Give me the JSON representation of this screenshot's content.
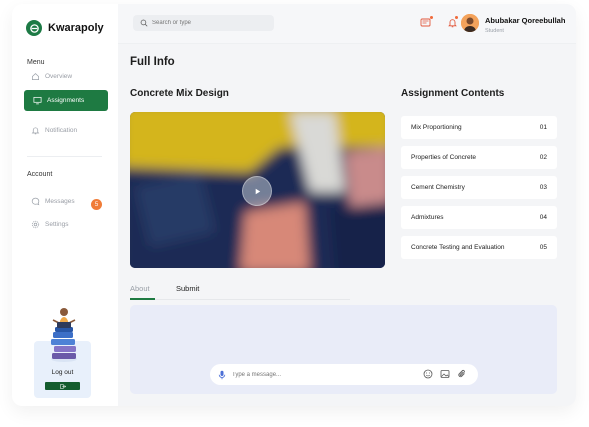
{
  "brand": {
    "name": "Kwarapoly"
  },
  "sidebar": {
    "menu_label": "Menu",
    "account_label": "Account",
    "items": [
      {
        "label": "Overview",
        "icon": "home-icon"
      },
      {
        "label": "Assignments",
        "icon": "monitor-icon",
        "active": true
      },
      {
        "label": "Notification",
        "icon": "bell-icon"
      }
    ],
    "account_items": [
      {
        "label": "Messages",
        "icon": "chat-icon",
        "badge": "5"
      },
      {
        "label": "Settings",
        "icon": "gear-icon"
      }
    ],
    "logout_label": "Log out"
  },
  "topbar": {
    "search_placeholder": "Search or type",
    "user_name": "Abubakar Qoreebullah",
    "user_role": "Student"
  },
  "main": {
    "page_title": "Full Info",
    "course_title": "Concrete Mix Design",
    "contents_title": "Assignment Contents",
    "tabs": [
      {
        "label": "About",
        "active": true
      },
      {
        "label": "Submit"
      }
    ],
    "message_placeholder": "Type a message..."
  },
  "assignments": [
    {
      "title": "Mix Proportioning",
      "number": "01"
    },
    {
      "title": "Properties of Concrete",
      "number": "02"
    },
    {
      "title": "Cement Chemistry",
      "number": "03"
    },
    {
      "title": "Admixtures",
      "number": "04"
    },
    {
      "title": "Concrete Testing and Evaluation",
      "number": "05"
    }
  ],
  "colors": {
    "brand_green": "#1e7a42",
    "badge_orange": "#f07c38",
    "panel": "#e9ecf8"
  }
}
